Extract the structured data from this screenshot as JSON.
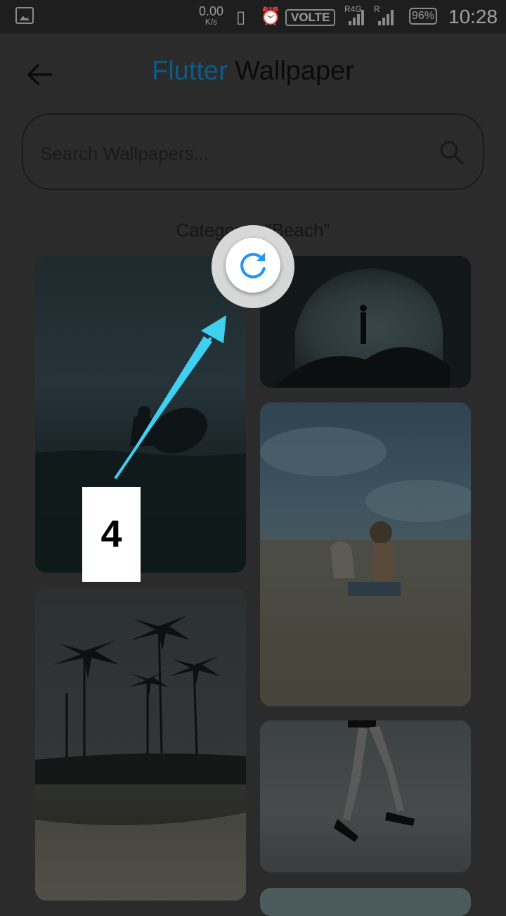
{
  "status_bar": {
    "net_speed": "0.00",
    "net_unit": "K/s",
    "volte": "VOLTE",
    "sim1_label": "R4G",
    "sim2_label": "R",
    "battery": "96%",
    "time": "10:28"
  },
  "header": {
    "title_accent": "Flutter",
    "title_main": "Wallpaper"
  },
  "search": {
    "placeholder": "Search Wallpapers..."
  },
  "category_label": "Category : \"Beach\"",
  "wallpapers": [
    {
      "subject": "surfer in ocean at dusk"
    },
    {
      "subject": "sea cave with person silhouette"
    },
    {
      "subject": "child with dog on beach"
    },
    {
      "subject": "palm trees on shore"
    },
    {
      "subject": "legs jumping on beach"
    }
  ],
  "annotation": {
    "step_number": "4",
    "arrow_color": "#3fd0f0"
  },
  "colors": {
    "accent": "#0d5a85",
    "refresh_icon": "#2196f3"
  }
}
